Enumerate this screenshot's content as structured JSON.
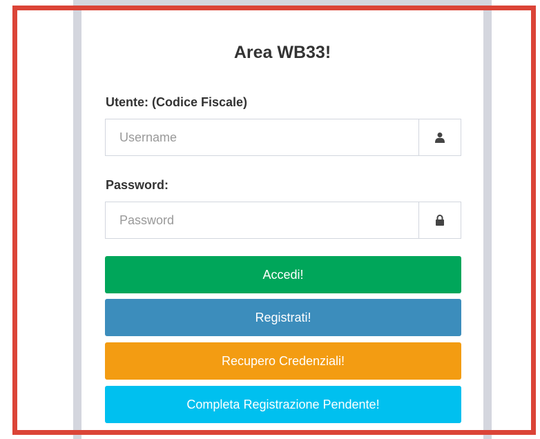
{
  "login": {
    "title": "Area WB33!",
    "username_label": "Utente: (Codice Fiscale)",
    "username_placeholder": "Username",
    "password_label": "Password:",
    "password_placeholder": "Password"
  },
  "buttons": {
    "login": "Accedi!",
    "register": "Registrati!",
    "recover": "Recupero Credenziali!",
    "complete": "Completa Registrazione Pendente!"
  },
  "colors": {
    "login": "#00a65a",
    "register": "#3c8dbc",
    "recover": "#f39c12",
    "complete": "#00c0ef",
    "highlight": "#db4437"
  },
  "icons": {
    "username_addon": "user-icon",
    "password_addon": "lock-icon"
  }
}
